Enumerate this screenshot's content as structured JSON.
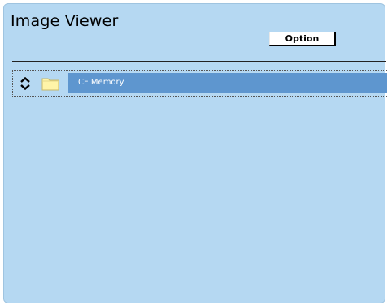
{
  "window": {
    "title": "Image Viewer"
  },
  "toolbar": {
    "option_label": "Option"
  },
  "list": {
    "items": [
      {
        "label": "CF Memory",
        "icon": "folder-icon",
        "selected": true
      }
    ]
  },
  "colors": {
    "background": "#b5d8f2",
    "selection": "#5e96cf",
    "folder": "#fff4a8"
  }
}
